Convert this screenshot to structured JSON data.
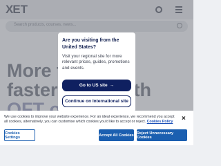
{
  "header": {
    "logo_mark": "X",
    "logo_text": "ET"
  },
  "search": {
    "placeholder": "Search products, courses, news..."
  },
  "hero": {
    "line1": "More t",
    "line2": "faster",
    "line2_end": "th",
    "line3": "OFT o"
  },
  "modal": {
    "title": "Are you visiting from the United States?",
    "body": "Visit your regional site for more relevant prices, guides, promotions and events.",
    "primary_label": "Go to US site",
    "primary_arrow": "→",
    "secondary_label": "Continue on International site"
  },
  "cookie_banner": {
    "text": "We use cookies to improve your website experience. For an ideal experience, we recommend you accept all cookies, alternatively, you can customise which cookies you'd like to accept or reject.",
    "policy_link": "Cookies Policy",
    "close": "×",
    "settings_label": "Cookies Settings",
    "accept_label": "Accept All Cookies",
    "reject_label": "Reject Unnecessary Cookies"
  },
  "colors": {
    "navy": "#0f2060",
    "cookie_blue": "#1b5fb0"
  }
}
